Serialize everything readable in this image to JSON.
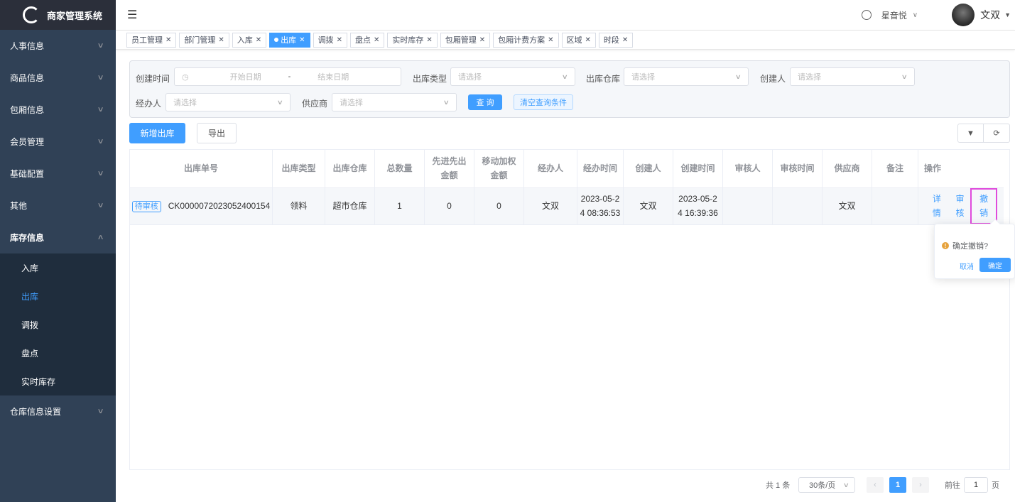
{
  "app": {
    "title": "商家管理系统"
  },
  "sidebar": {
    "items": [
      {
        "label": "人事信息"
      },
      {
        "label": "商品信息"
      },
      {
        "label": "包厢信息"
      },
      {
        "label": "会员管理"
      },
      {
        "label": "基础配置"
      },
      {
        "label": "其他"
      },
      {
        "label": "库存信息"
      }
    ],
    "sub_items": [
      {
        "label": "入库"
      },
      {
        "label": "出库"
      },
      {
        "label": "调拨"
      },
      {
        "label": "盘点"
      },
      {
        "label": "实时库存"
      }
    ],
    "last_item": {
      "label": "仓库信息设置"
    }
  },
  "header": {
    "store_name": "星音悦",
    "user_name": "文双"
  },
  "tags": [
    {
      "label": "员工管理"
    },
    {
      "label": "部门管理"
    },
    {
      "label": "入库"
    },
    {
      "label": "出库",
      "active": true
    },
    {
      "label": "调拨"
    },
    {
      "label": "盘点"
    },
    {
      "label": "实时库存"
    },
    {
      "label": "包厢管理"
    },
    {
      "label": "包厢计费方案"
    },
    {
      "label": "区域"
    },
    {
      "label": "时段"
    }
  ],
  "filter": {
    "create_time_label": "创建时间",
    "start_placeholder": "开始日期",
    "range_sep": "-",
    "end_placeholder": "结束日期",
    "out_type_label": "出库类型",
    "out_type_placeholder": "请选择",
    "warehouse_label": "出库仓库",
    "warehouse_placeholder": "请选择",
    "creator_label": "创建人",
    "creator_placeholder": "请选择",
    "handler_label": "经办人",
    "handler_placeholder": "请选择",
    "supplier_label": "供应商",
    "supplier_placeholder": "请选择",
    "query_button": "查 询",
    "clear_button": "清空查询条件"
  },
  "toolbar": {
    "add_button": "新增出库",
    "export_button": "导出"
  },
  "table": {
    "headers": [
      "出库单号",
      "出库类型",
      "出库仓库",
      "总数量",
      "先进先出\n金额",
      "移动加权\n金额",
      "经办人",
      "经办时间",
      "创建人",
      "创建时间",
      "审核人",
      "审核时间",
      "供应商",
      "备注",
      "操作"
    ],
    "row": {
      "status": "待审核",
      "order_no": "CK0000072023052400154",
      "out_type": "领料",
      "warehouse": "超市仓库",
      "total_qty": "1",
      "fifo_amount": "0",
      "weighted_amount": "0",
      "handler": "文双",
      "handle_time": "2023-05-2\n4 08:36:53",
      "creator": "文双",
      "create_time": "2023-05-2\n4 16:39:36",
      "auditor": "",
      "audit_time": "",
      "supplier": "文双",
      "remark": "",
      "actions": {
        "detail": "详情",
        "audit": "审核",
        "revoke": "撤销"
      }
    }
  },
  "popconfirm": {
    "message": "确定撤销?",
    "cancel": "取消",
    "confirm": "确定"
  },
  "pagination": {
    "total_text": "共 1 条",
    "page_size": "30条/页",
    "current_page": "1",
    "goto_prefix": "前往",
    "goto_value": "1",
    "goto_suffix": "页"
  }
}
